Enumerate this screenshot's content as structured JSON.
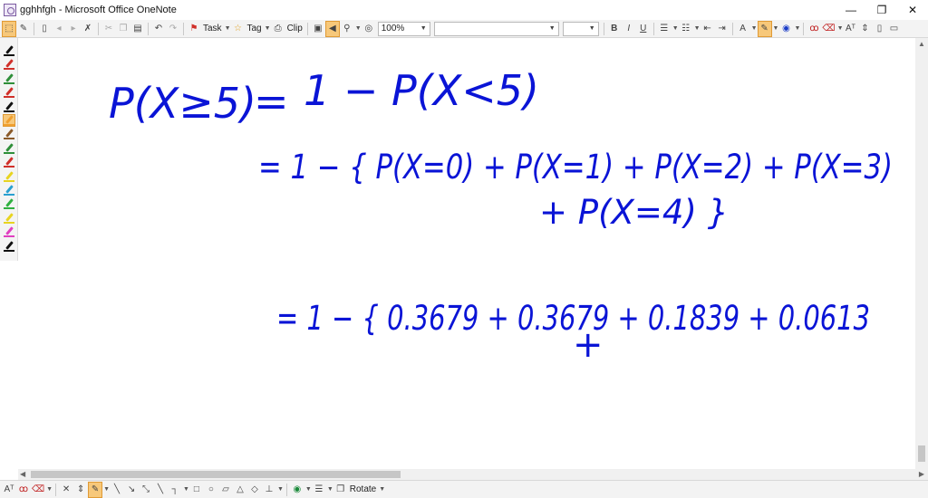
{
  "window": {
    "title": "gghhfgh - Microsoft Office OneNote",
    "minimize": "—",
    "maximize": "❐",
    "close": "✕"
  },
  "toolbar": {
    "task_label": "Task",
    "tag_label": "Tag",
    "clip_label": "Clip",
    "zoom_value": "100%",
    "font_value": "",
    "size_value": "",
    "bold": "B",
    "italic": "I",
    "underline": "U",
    "clear_format": "A"
  },
  "drawbar": {
    "rotate_label": "Rotate"
  },
  "pens": [
    {
      "color": "#111111"
    },
    {
      "color": "#d0302a"
    },
    {
      "color": "#2f8f3a"
    },
    {
      "color": "#d0302a"
    },
    {
      "color": "#111111"
    },
    {
      "color": "#f0a030",
      "selected": true
    },
    {
      "color": "#8a5a2a"
    },
    {
      "color": "#2f8f3a"
    },
    {
      "color": "#d0302a"
    },
    {
      "color": "#e8d420"
    },
    {
      "color": "#2aa0d0"
    },
    {
      "color": "#30b040"
    },
    {
      "color": "#e8d420"
    },
    {
      "color": "#e040c0"
    },
    {
      "color": "#111111"
    }
  ],
  "ink": {
    "color": "#0a14d6",
    "line1_left": "P(X≥5)",
    "line1_equals": "=",
    "line1_right": "1 − P(X<5)",
    "line2": "= 1 − { P(X=0) + P(X=1) + P(X=2) + P(X=3)",
    "line3": "+ P(X=4) }",
    "line4": "= 1 − { 0.3679 + 0.3679 + 0.1839 + 0.0613",
    "line5": "+"
  }
}
